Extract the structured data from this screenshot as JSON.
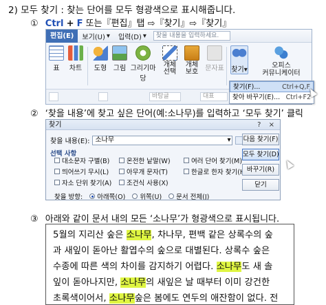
{
  "heading": "2) 모두 찾기 : 찾는 단어를 모두 형광색으로 표시해줍니다.",
  "step1": {
    "num": "①",
    "ctrl": "Ctrl",
    "plus": "+",
    "f": "F",
    "rest": "또는『편집』탭 ⇨『찾기』⇨『찾기』"
  },
  "ribbon": {
    "menu": {
      "edit": "편집(E)",
      "view": "보기(U)",
      "input": "입력(D)"
    },
    "search_placeholder": "찾을 내용을 입력하세요.",
    "tools": [
      "표",
      "차트",
      "도형",
      "그림",
      "그리기마당",
      "개체\n선택",
      "개체\n보호",
      "문자표",
      "찾기",
      "오피스\n커뮤니케이터"
    ],
    "strip": {
      "bar": "바탕글",
      "rep": "대표"
    },
    "dropdown": [
      {
        "label": "찾기(F)...",
        "key": "Ctrl+Q,F"
      },
      {
        "label": "찾아 바꾸기(E)...",
        "key": "Ctrl+F2"
      }
    ]
  },
  "step2": {
    "num": "②",
    "text": "‘찾을 내용’에 찾고 싶은 단어(예:소나무)를 입력하고 ‘모두 찾기’ 클릭"
  },
  "dialog": {
    "title": "찾기",
    "title_buttons": "? ×",
    "find_label": "찾을 내용(E):",
    "find_value": "소나무",
    "options_title": "선택 사항",
    "checks": [
      "대소문자 구별(B)",
      "온전한 낱말(W)",
      "여러 단어 찾기(M)",
      "띄어쓰기 무시(L)",
      "아무개 문자(T)",
      "한글로 한자 찾기(H)",
      "자소 단위 찾기(A)",
      "조건식 사용(X)"
    ],
    "direction_label": "찾을 방향:",
    "radios": [
      "아래쪽(O)",
      "위쪽(U)",
      "문서 전체(J)"
    ],
    "buttons": [
      "다음 찾기(F)",
      "모두 찾기(D)",
      "바꾸기(R)",
      "닫기"
    ]
  },
  "step3": {
    "num": "③",
    "text": "아래와 같이 문서 내의 모든 ‘소나무’가 형광색으로 표시됩니다."
  },
  "paragraph": {
    "lines": [
      [
        {
          "t": "5월의 지리산 숲은 "
        },
        {
          "t": "소나무",
          "h": true
        },
        {
          "t": ", 차나무, 편백 같은 상록수의 숲"
        }
      ],
      [
        {
          "t": "과 새잎이 돋아난 활엽수의 숲으로 대별된다. 상록수 숲은"
        }
      ],
      [
        {
          "t": "수종에 따른 색의 차이를 감지하기 어렵다. "
        },
        {
          "t": "소나무",
          "h": true
        },
        {
          "t": "도 새 솔"
        }
      ],
      [
        {
          "t": "잎이 돋아나지만, "
        },
        {
          "t": "소나무",
          "h": true
        },
        {
          "t": "의 새잎은 날 때부터 이미 강건한"
        }
      ],
      [
        {
          "t": "초록색이어서, "
        },
        {
          "t": "소나무",
          "h": true
        },
        {
          "t": "숲은 봄에도 연두의 애잔함이 없다. 전"
        }
      ]
    ],
    "highlight_color": "#dff542"
  }
}
